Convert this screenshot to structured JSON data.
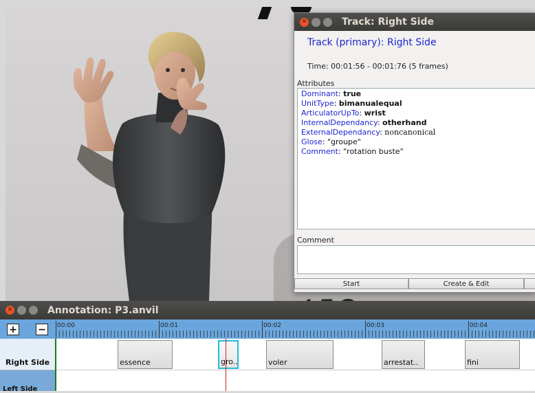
{
  "track_window": {
    "title": "Track: Right Side",
    "heading": "Track (primary): Right Side",
    "time": "Time: 00:01:56 - 00:01:76 (5 frames)",
    "attributes_caption": "Attributes",
    "attributes": [
      {
        "key": "Dominant",
        "value": "true"
      },
      {
        "key": "UnitType",
        "value": "bimanualequal"
      },
      {
        "key": "ArticulatorUpTo",
        "value": "wrist"
      },
      {
        "key": "InternalDependancy",
        "value": "otherhand"
      },
      {
        "key": "ExternalDependancy",
        "value": "noncanonical"
      },
      {
        "key": "Glose",
        "value": "\"groupe\""
      },
      {
        "key": "Comment",
        "value": "\"rotation buste\""
      }
    ],
    "comment_caption": "Comment",
    "buttons": {
      "start": "Start",
      "create_edit": "Create & Edit"
    }
  },
  "annotation_window": {
    "title": "Annotation: P3.anvil",
    "zoom_in": "+",
    "zoom_out": "−",
    "ruler_labels": [
      "00:00",
      "00:01",
      "00:02",
      "00:03",
      "00:04"
    ],
    "track_name": "Right Side",
    "track2_name_partial": "Left Side",
    "elements": [
      {
        "label": "essence"
      },
      {
        "label": "gro.."
      },
      {
        "label": "voler"
      },
      {
        "label": "arrestat.."
      },
      {
        "label": "fini"
      }
    ]
  },
  "colors": {
    "heading_blue": "#1c24d0",
    "toolbar_blue": "#6aa6dd",
    "selection_cyan": "#22b8e0",
    "playhead_red": "#cc2222",
    "titlebar_dark": "#3c3b37",
    "close_orange": "#e8532a"
  }
}
